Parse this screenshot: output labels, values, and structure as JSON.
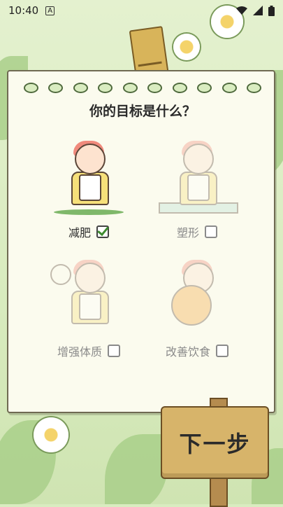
{
  "status_bar": {
    "time": "10:40",
    "indicator": "A",
    "icons": [
      "wifi-icon",
      "signal-icon",
      "battery-icon"
    ]
  },
  "page": {
    "title": "你的目标是什么？"
  },
  "options": [
    {
      "label": "减肥",
      "checked": true
    },
    {
      "label": "塑形",
      "checked": false
    },
    {
      "label": "增强体质",
      "checked": false
    },
    {
      "label": "改善饮食",
      "checked": false
    }
  ],
  "next_button": {
    "label": "下一步"
  },
  "colors": {
    "card": "#fbfbee",
    "background": "#d9ecc0",
    "check": "#3e8b2f",
    "sign": "#d7b46a"
  }
}
